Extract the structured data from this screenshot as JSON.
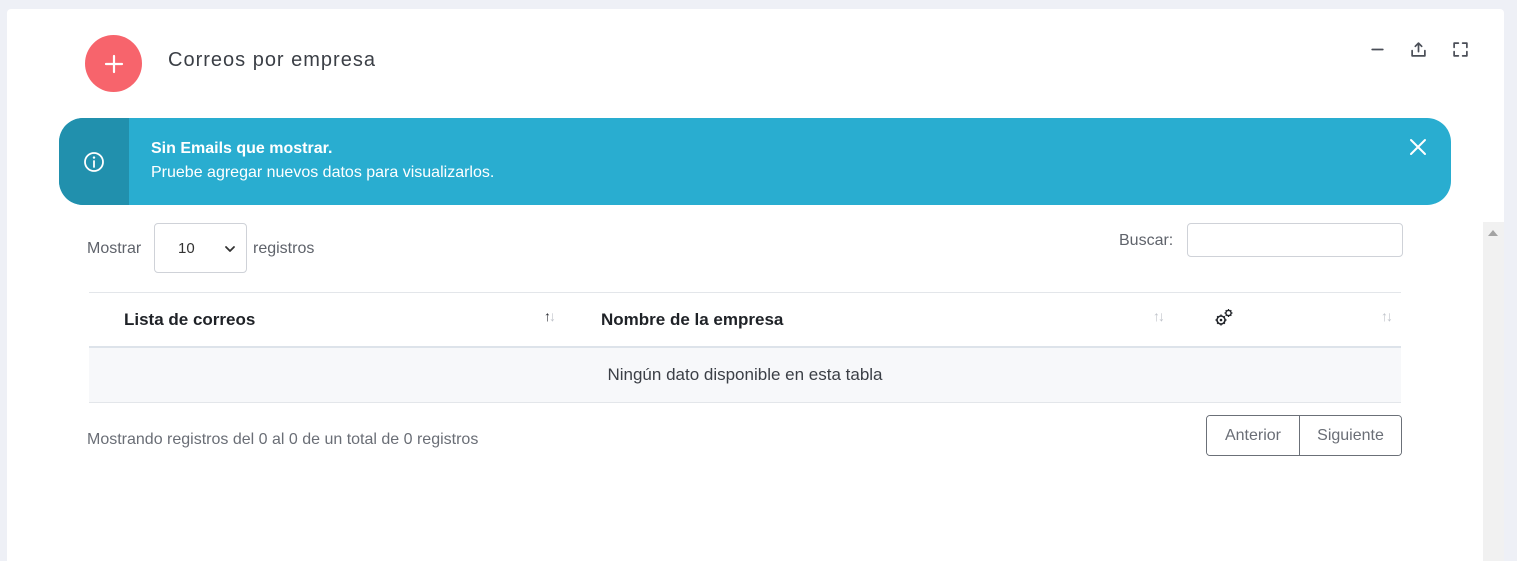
{
  "header": {
    "title": "Correos por empresa",
    "add_icon": "plus-icon",
    "tools": [
      "minimize-icon",
      "export-icon",
      "fullscreen-icon"
    ]
  },
  "alert": {
    "title": "Sin Emails que mostrar.",
    "message": "Pruebe agregar nuevos datos para visualizarlos.",
    "icon": "info-icon",
    "close_icon": "close-icon"
  },
  "controls": {
    "length_prefix": "Mostrar",
    "length_value": "10",
    "length_suffix": "registros",
    "search_label": "Buscar:",
    "search_value": ""
  },
  "table": {
    "columns": [
      {
        "label": "Lista de correos",
        "sort": "asc"
      },
      {
        "label": "Nombre de la empresa",
        "sort": "none"
      },
      {
        "label": "",
        "icon": "gears-icon",
        "sort": "none"
      }
    ],
    "empty_message": "Ningún dato disponible en esta tabla"
  },
  "footer": {
    "info": "Mostrando registros del 0 al 0 de un total de 0 registros",
    "prev_label": "Anterior",
    "next_label": "Siguiente"
  },
  "colors": {
    "add_button": "#f7646c",
    "alert_bg": "#29add0",
    "alert_side": "#2190ad"
  }
}
